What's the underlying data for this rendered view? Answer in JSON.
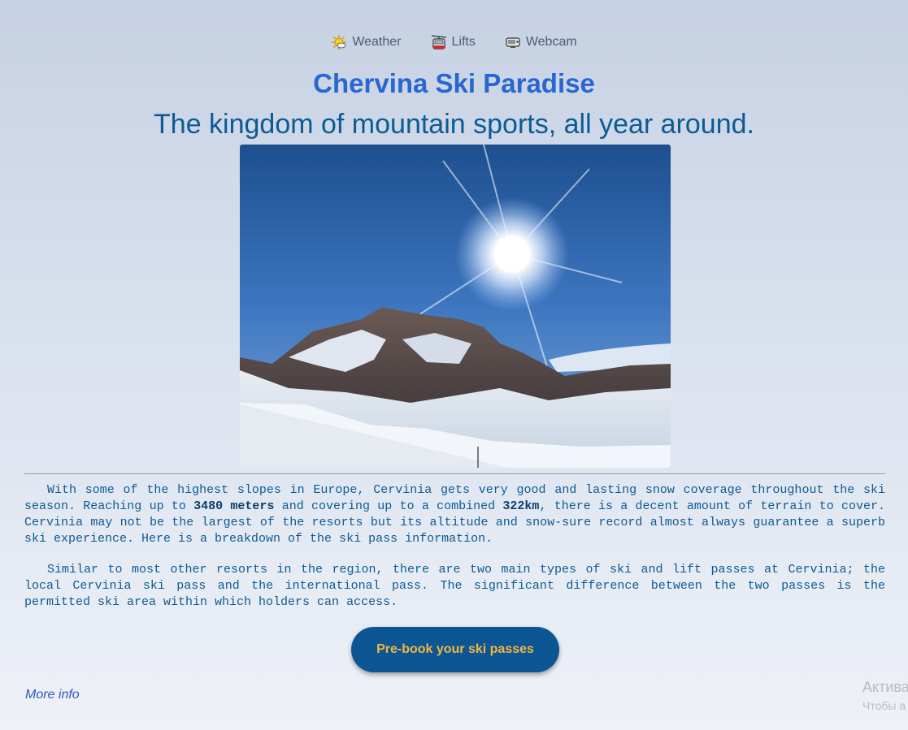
{
  "nav": {
    "items": [
      {
        "label": "Weather",
        "icon": "sun-cloud-icon"
      },
      {
        "label": "Lifts",
        "icon": "cable-car-icon"
      },
      {
        "label": "Webcam",
        "icon": "webcam-icon"
      }
    ]
  },
  "header": {
    "title": "Chervina Ski Paradise",
    "subtitle": "The kingdom of mountain sports, all year around."
  },
  "content": {
    "p1": {
      "t1": "With some of the highest slopes in Europe, Cervinia gets very good and lasting snow coverage throughout the ski season. Reaching up to ",
      "b1": "3480 meters",
      "t2": " and covering up to a combined ",
      "b2": "322km",
      "t3": ", there is a decent amount of terrain to cover. Cervinia may not be the largest of the resorts but its altitude and snow-sure record almost always guarantee a superb ski experience. Here is a breakdown of the ski pass information."
    },
    "p2": "Similar to most other resorts in the region, there are two main types of ski and lift passes at Cervinia; the local Cervinia ski pass and the international pass. The significant difference between the two passes is the permitted ski area within which holders can access."
  },
  "cta": {
    "label": "Pre-book your ski passes"
  },
  "footer": {
    "more_info": "More info"
  },
  "watermark": {
    "line1": "Актива",
    "line2": "Чтобы а"
  },
  "colors": {
    "title": "#2866d1",
    "subtitle": "#0c5b94",
    "button_bg": "#0d5694",
    "button_text": "#f2b640",
    "link": "#2e58b8"
  }
}
